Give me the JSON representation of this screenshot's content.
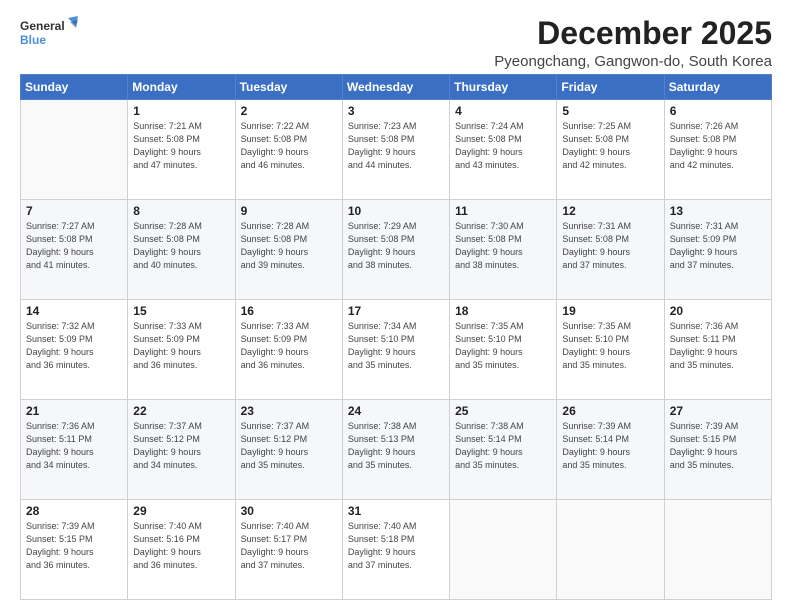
{
  "logo": {
    "line1": "General",
    "line2": "Blue"
  },
  "title": "December 2025",
  "subtitle": "Pyeongchang, Gangwon-do, South Korea",
  "days_header": [
    "Sunday",
    "Monday",
    "Tuesday",
    "Wednesday",
    "Thursday",
    "Friday",
    "Saturday"
  ],
  "weeks": [
    [
      {
        "day": "",
        "info": ""
      },
      {
        "day": "1",
        "info": "Sunrise: 7:21 AM\nSunset: 5:08 PM\nDaylight: 9 hours\nand 47 minutes."
      },
      {
        "day": "2",
        "info": "Sunrise: 7:22 AM\nSunset: 5:08 PM\nDaylight: 9 hours\nand 46 minutes."
      },
      {
        "day": "3",
        "info": "Sunrise: 7:23 AM\nSunset: 5:08 PM\nDaylight: 9 hours\nand 44 minutes."
      },
      {
        "day": "4",
        "info": "Sunrise: 7:24 AM\nSunset: 5:08 PM\nDaylight: 9 hours\nand 43 minutes."
      },
      {
        "day": "5",
        "info": "Sunrise: 7:25 AM\nSunset: 5:08 PM\nDaylight: 9 hours\nand 42 minutes."
      },
      {
        "day": "6",
        "info": "Sunrise: 7:26 AM\nSunset: 5:08 PM\nDaylight: 9 hours\nand 42 minutes."
      }
    ],
    [
      {
        "day": "7",
        "info": "Sunrise: 7:27 AM\nSunset: 5:08 PM\nDaylight: 9 hours\nand 41 minutes."
      },
      {
        "day": "8",
        "info": "Sunrise: 7:28 AM\nSunset: 5:08 PM\nDaylight: 9 hours\nand 40 minutes."
      },
      {
        "day": "9",
        "info": "Sunrise: 7:28 AM\nSunset: 5:08 PM\nDaylight: 9 hours\nand 39 minutes."
      },
      {
        "day": "10",
        "info": "Sunrise: 7:29 AM\nSunset: 5:08 PM\nDaylight: 9 hours\nand 38 minutes."
      },
      {
        "day": "11",
        "info": "Sunrise: 7:30 AM\nSunset: 5:08 PM\nDaylight: 9 hours\nand 38 minutes."
      },
      {
        "day": "12",
        "info": "Sunrise: 7:31 AM\nSunset: 5:08 PM\nDaylight: 9 hours\nand 37 minutes."
      },
      {
        "day": "13",
        "info": "Sunrise: 7:31 AM\nSunset: 5:09 PM\nDaylight: 9 hours\nand 37 minutes."
      }
    ],
    [
      {
        "day": "14",
        "info": "Sunrise: 7:32 AM\nSunset: 5:09 PM\nDaylight: 9 hours\nand 36 minutes."
      },
      {
        "day": "15",
        "info": "Sunrise: 7:33 AM\nSunset: 5:09 PM\nDaylight: 9 hours\nand 36 minutes."
      },
      {
        "day": "16",
        "info": "Sunrise: 7:33 AM\nSunset: 5:09 PM\nDaylight: 9 hours\nand 36 minutes."
      },
      {
        "day": "17",
        "info": "Sunrise: 7:34 AM\nSunset: 5:10 PM\nDaylight: 9 hours\nand 35 minutes."
      },
      {
        "day": "18",
        "info": "Sunrise: 7:35 AM\nSunset: 5:10 PM\nDaylight: 9 hours\nand 35 minutes."
      },
      {
        "day": "19",
        "info": "Sunrise: 7:35 AM\nSunset: 5:10 PM\nDaylight: 9 hours\nand 35 minutes."
      },
      {
        "day": "20",
        "info": "Sunrise: 7:36 AM\nSunset: 5:11 PM\nDaylight: 9 hours\nand 35 minutes."
      }
    ],
    [
      {
        "day": "21",
        "info": "Sunrise: 7:36 AM\nSunset: 5:11 PM\nDaylight: 9 hours\nand 34 minutes."
      },
      {
        "day": "22",
        "info": "Sunrise: 7:37 AM\nSunset: 5:12 PM\nDaylight: 9 hours\nand 34 minutes."
      },
      {
        "day": "23",
        "info": "Sunrise: 7:37 AM\nSunset: 5:12 PM\nDaylight: 9 hours\nand 35 minutes."
      },
      {
        "day": "24",
        "info": "Sunrise: 7:38 AM\nSunset: 5:13 PM\nDaylight: 9 hours\nand 35 minutes."
      },
      {
        "day": "25",
        "info": "Sunrise: 7:38 AM\nSunset: 5:14 PM\nDaylight: 9 hours\nand 35 minutes."
      },
      {
        "day": "26",
        "info": "Sunrise: 7:39 AM\nSunset: 5:14 PM\nDaylight: 9 hours\nand 35 minutes."
      },
      {
        "day": "27",
        "info": "Sunrise: 7:39 AM\nSunset: 5:15 PM\nDaylight: 9 hours\nand 35 minutes."
      }
    ],
    [
      {
        "day": "28",
        "info": "Sunrise: 7:39 AM\nSunset: 5:15 PM\nDaylight: 9 hours\nand 36 minutes."
      },
      {
        "day": "29",
        "info": "Sunrise: 7:40 AM\nSunset: 5:16 PM\nDaylight: 9 hours\nand 36 minutes."
      },
      {
        "day": "30",
        "info": "Sunrise: 7:40 AM\nSunset: 5:17 PM\nDaylight: 9 hours\nand 37 minutes."
      },
      {
        "day": "31",
        "info": "Sunrise: 7:40 AM\nSunset: 5:18 PM\nDaylight: 9 hours\nand 37 minutes."
      },
      {
        "day": "",
        "info": ""
      },
      {
        "day": "",
        "info": ""
      },
      {
        "day": "",
        "info": ""
      }
    ]
  ]
}
